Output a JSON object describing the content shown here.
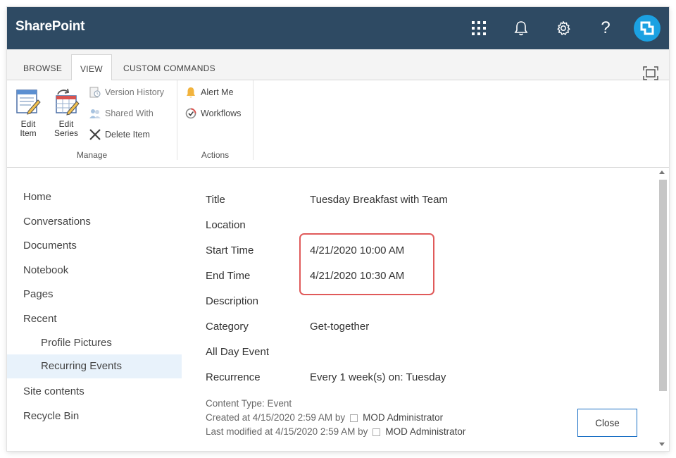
{
  "suite_bar": {
    "brand": "SharePoint",
    "icons": [
      "app-launcher-icon",
      "bell-icon",
      "gear-icon",
      "help-icon"
    ],
    "help_glyph": "?",
    "bg_color": "#2e4a63",
    "avatar_color": "#1ba1e2"
  },
  "ribbon": {
    "tabs": [
      "BROWSE",
      "VIEW",
      "CUSTOM COMMANDS"
    ],
    "active_tab": "VIEW",
    "groups": {
      "manage": {
        "label": "Manage",
        "edit_item": [
          "Edit",
          "Item"
        ],
        "edit_series": [
          "Edit",
          "Series"
        ],
        "version_history": "Version History",
        "shared_with": "Shared With",
        "delete_item": "Delete Item"
      },
      "actions": {
        "label": "Actions",
        "alert_me": "Alert Me",
        "workflows": "Workflows"
      }
    }
  },
  "nav": {
    "items": [
      {
        "label": "Home"
      },
      {
        "label": "Conversations"
      },
      {
        "label": "Documents"
      },
      {
        "label": "Notebook"
      },
      {
        "label": "Pages"
      },
      {
        "label": "Recent"
      },
      {
        "label": "Profile Pictures"
      },
      {
        "label": "Recurring Events"
      },
      {
        "label": "Site contents"
      },
      {
        "label": "Recycle Bin"
      }
    ],
    "selected": "Recurring Events"
  },
  "item": {
    "fields": [
      {
        "label": "Title",
        "value": "Tuesday Breakfast with Team"
      },
      {
        "label": "Location",
        "value": ""
      },
      {
        "label": "Start Time",
        "value": "4/21/2020 10:00 AM"
      },
      {
        "label": "End Time",
        "value": "4/21/2020 10:30 AM"
      },
      {
        "label": "Description",
        "value": ""
      },
      {
        "label": "Category",
        "value": "Get-together"
      },
      {
        "label": "All Day Event",
        "value": ""
      },
      {
        "label": "Recurrence",
        "value": "Every 1 week(s) on: Tuesday"
      }
    ],
    "content_type": "Content Type: Event",
    "created_prefix": "Created at 4/15/2020 2:59 AM by",
    "created_by": "MOD Administrator",
    "modified_prefix": "Last modified at 4/15/2020 2:59 AM by",
    "modified_by": "MOD Administrator",
    "highlight_color": "#e05a5a"
  },
  "footer": {
    "close_label": "Close"
  }
}
